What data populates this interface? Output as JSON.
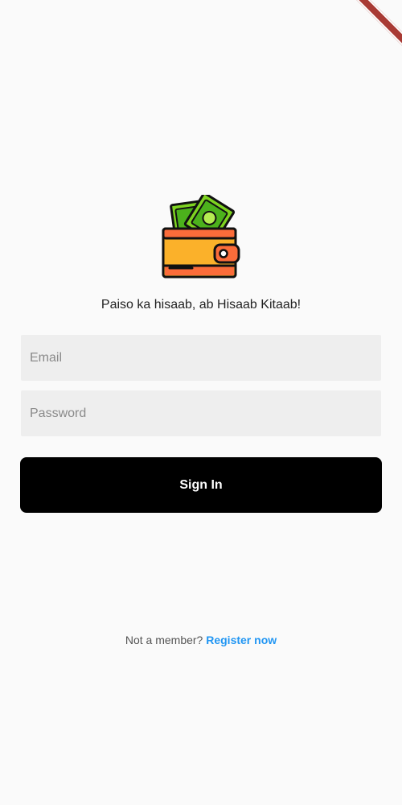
{
  "app": {
    "tagline": "Paiso ka hisaab, ab Hisaab Kitaab!",
    "logo_icon": "wallet-with-cash-icon"
  },
  "form": {
    "email_placeholder": "Email",
    "email_value": "",
    "password_placeholder": "Password",
    "password_value": ""
  },
  "actions": {
    "sign_in_label": "Sign In"
  },
  "footer": {
    "prompt": "Not a member?",
    "register_label": "Register now"
  },
  "colors": {
    "background": "#fafafa",
    "field_bg": "#eeeeee",
    "button_bg": "#000000",
    "link": "#2196f3",
    "wallet_body": "#fbb12a",
    "wallet_strap": "#fb6c3a",
    "cash": "#7ed321"
  }
}
